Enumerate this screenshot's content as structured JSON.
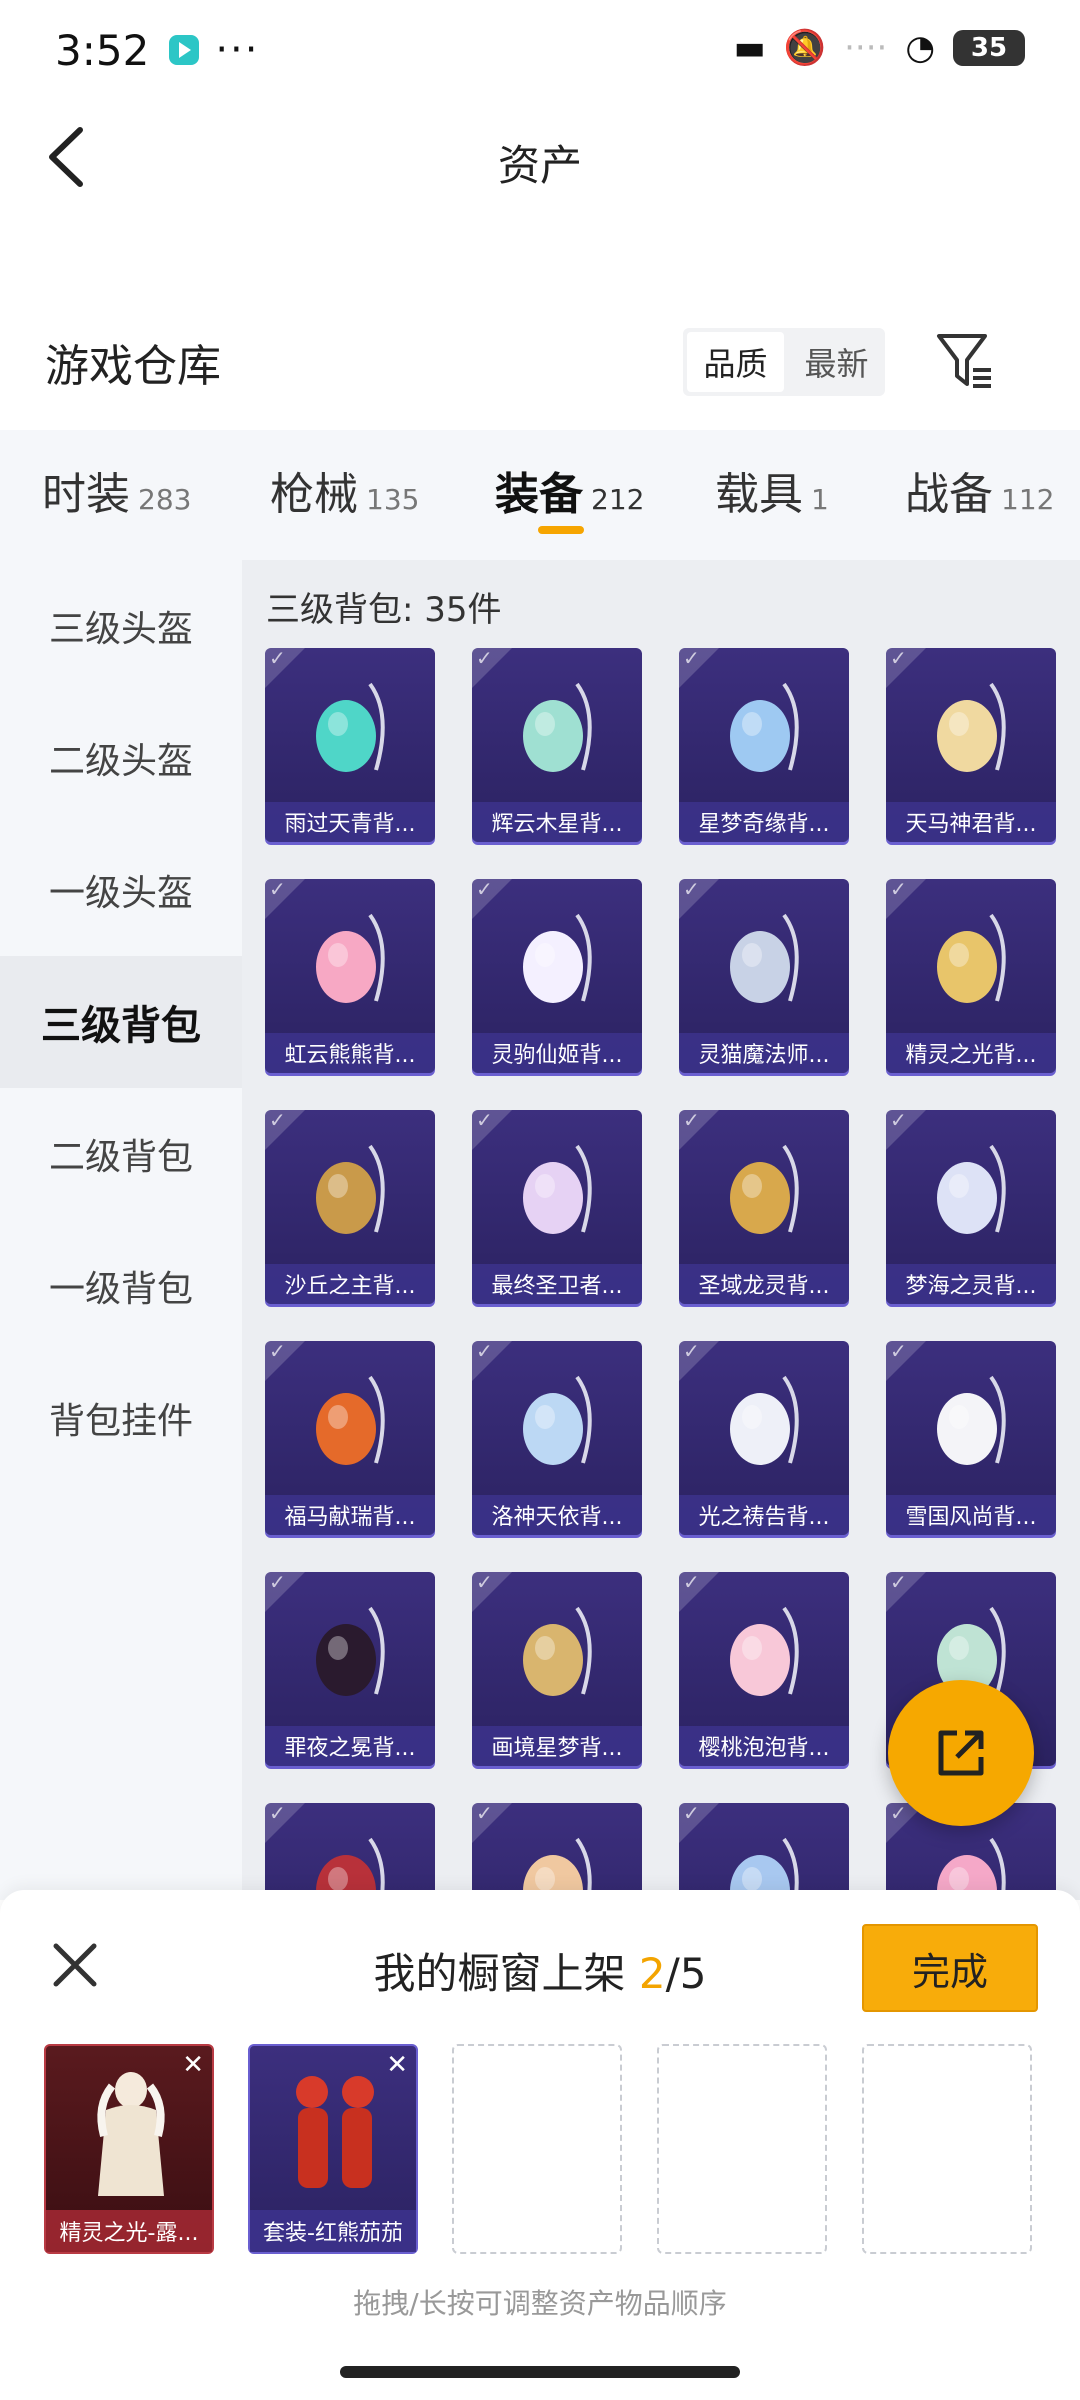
{
  "status": {
    "time": "3:52",
    "battery": "35"
  },
  "header": {
    "title": "资产"
  },
  "warehouse": {
    "title": "游戏仓库",
    "sort_options": [
      "品质",
      "最新"
    ]
  },
  "tabs": [
    {
      "label": "时装",
      "count": "283"
    },
    {
      "label": "枪械",
      "count": "135"
    },
    {
      "label": "装备",
      "count": "212"
    },
    {
      "label": "载具",
      "count": "1"
    },
    {
      "label": "战备",
      "count": "112"
    }
  ],
  "side_menu": [
    "三级头盔",
    "二级头盔",
    "一级头盔",
    "三级背包",
    "二级背包",
    "一级背包",
    "背包挂件"
  ],
  "grid": {
    "heading": "三级背包: 35件",
    "items": [
      {
        "name": "雨过天青背...",
        "color": "#4fd6c8"
      },
      {
        "name": "辉云木星背...",
        "color": "#9fe0d2"
      },
      {
        "name": "星梦奇缘背...",
        "color": "#9ec9f2"
      },
      {
        "name": "天马神君背...",
        "color": "#f0d9a0"
      },
      {
        "name": "虹云熊熊背...",
        "color": "#f7a8c4"
      },
      {
        "name": "灵驹仙姬背...",
        "color": "#f4f0ff"
      },
      {
        "name": "灵猫魔法师...",
        "color": "#c8d2e6"
      },
      {
        "name": "精灵之光背...",
        "color": "#e8c56a"
      },
      {
        "name": "沙丘之主背...",
        "color": "#c99a4a"
      },
      {
        "name": "最终圣卫者...",
        "color": "#e6d2f4"
      },
      {
        "name": "圣域龙灵背...",
        "color": "#d8a84c"
      },
      {
        "name": "梦海之灵背...",
        "color": "#dde2f6"
      },
      {
        "name": "福马献瑞背...",
        "color": "#e56a2a"
      },
      {
        "name": "洛神天依背...",
        "color": "#bcd8f4"
      },
      {
        "name": "光之祷告背...",
        "color": "#eef0f8"
      },
      {
        "name": "雪国风尚背...",
        "color": "#f4f4f8"
      },
      {
        "name": "罪夜之冕背...",
        "color": "#2a1a2e"
      },
      {
        "name": "画境星梦背...",
        "color": "#d9b56e"
      },
      {
        "name": "樱桃泡泡背...",
        "color": "#f8c8d8"
      },
      {
        "name": "",
        "color": "#bfe3d4"
      },
      {
        "name": "",
        "color": "#b8313a"
      },
      {
        "name": "",
        "color": "#f0c8a0"
      },
      {
        "name": "",
        "color": "#a8c8f0"
      },
      {
        "name": "",
        "color": "#f5a8c8"
      }
    ]
  },
  "sheet": {
    "title_prefix": "我的橱窗上架 ",
    "count_current": "2",
    "count_total": "/5",
    "done_label": "完成",
    "slots": [
      {
        "name": "精灵之光-露...",
        "style": "red"
      },
      {
        "name": "套装-红熊茄茄",
        "style": "blue"
      },
      {
        "name": "",
        "style": "empty"
      },
      {
        "name": "",
        "style": "empty"
      },
      {
        "name": "",
        "style": "empty"
      }
    ],
    "hint": "拖拽/长按可调整资产物品顺序"
  },
  "colors": {
    "accent": "#f6a800",
    "card_bg": "#2f2570"
  }
}
